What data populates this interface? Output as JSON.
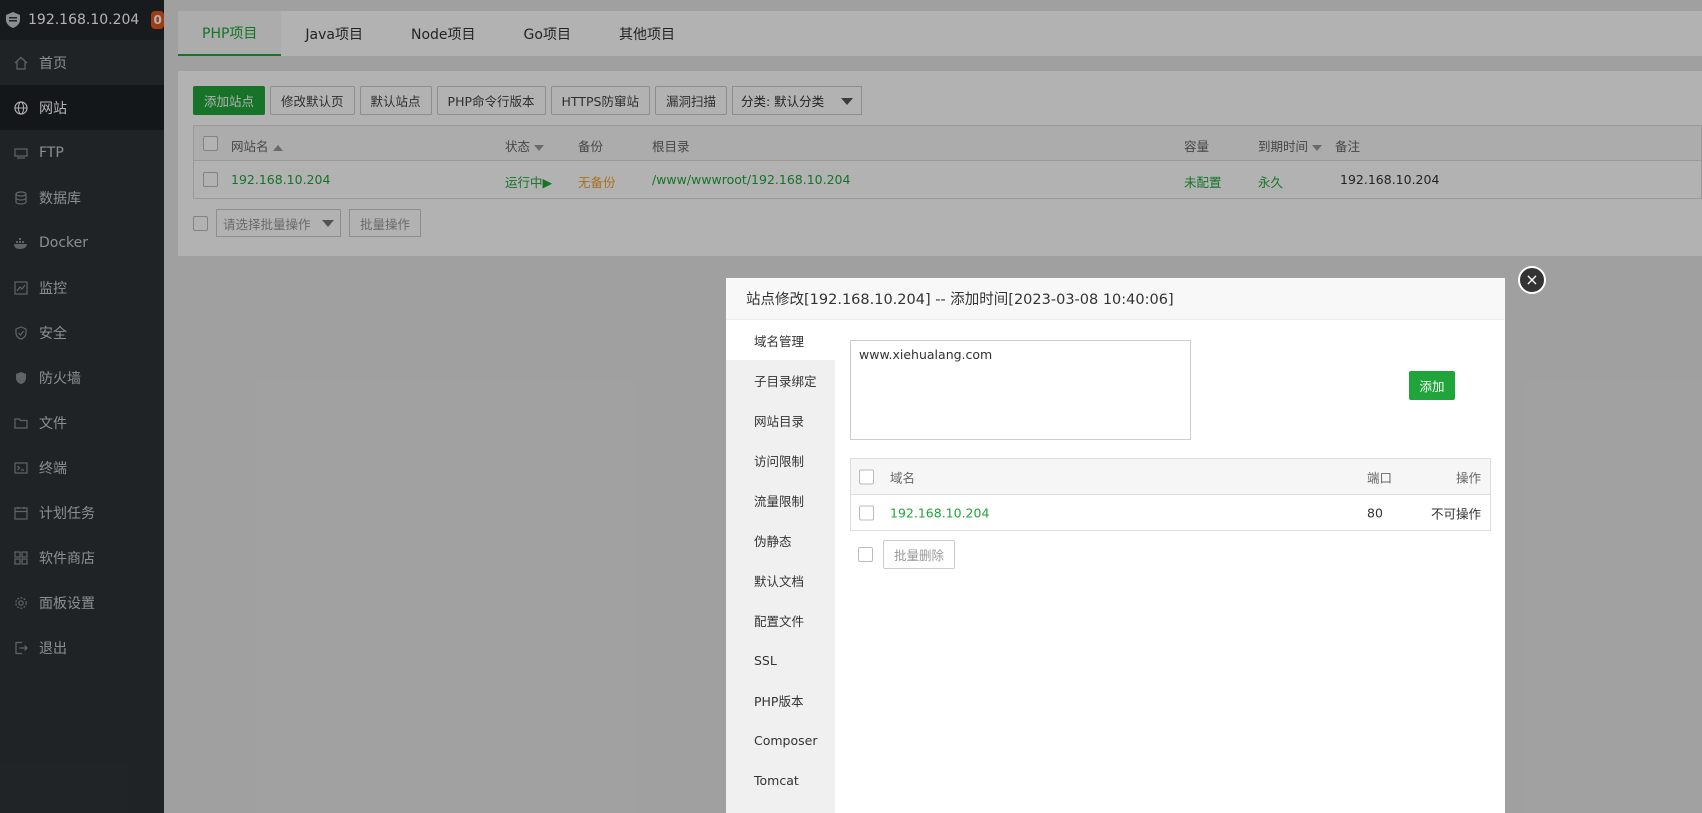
{
  "sidebar": {
    "server_ip": "192.168.10.204",
    "badge_count": "0",
    "items": [
      {
        "label": "首页",
        "icon": "home-icon"
      },
      {
        "label": "网站",
        "icon": "globe-icon"
      },
      {
        "label": "FTP",
        "icon": "ftp-icon"
      },
      {
        "label": "数据库",
        "icon": "database-icon"
      },
      {
        "label": "Docker",
        "icon": "docker-icon"
      },
      {
        "label": "监控",
        "icon": "monitor-icon"
      },
      {
        "label": "安全",
        "icon": "shield-icon"
      },
      {
        "label": "防火墙",
        "icon": "firewall-icon"
      },
      {
        "label": "文件",
        "icon": "folder-icon"
      },
      {
        "label": "终端",
        "icon": "terminal-icon"
      },
      {
        "label": "计划任务",
        "icon": "calendar-icon"
      },
      {
        "label": "软件商店",
        "icon": "apps-icon"
      },
      {
        "label": "面板设置",
        "icon": "gear-icon"
      },
      {
        "label": "退出",
        "icon": "logout-icon"
      }
    ],
    "active_index": 1
  },
  "tabs": [
    {
      "label": "PHP项目"
    },
    {
      "label": "Java项目"
    },
    {
      "label": "Node项目"
    },
    {
      "label": "Go项目"
    },
    {
      "label": "其他项目"
    }
  ],
  "toolbar": {
    "add_site": "添加站点",
    "modify_default_page": "修改默认页",
    "default_site": "默认站点",
    "php_cli_version": "PHP命令行版本",
    "https_anti_tamper": "HTTPS防窜站",
    "vuln_scan": "漏洞扫描",
    "category_select": "分类: 默认分类"
  },
  "site_table": {
    "headers": {
      "name": "网站名",
      "status": "状态",
      "backup": "备份",
      "root": "根目录",
      "capacity": "容量",
      "expire": "到期时间",
      "note": "备注"
    },
    "rows": [
      {
        "name": "192.168.10.204",
        "status": "运行中▶",
        "backup": "无备份",
        "root": "/www/wwwroot/192.168.10.204",
        "capacity": "未配置",
        "expire": "永久",
        "note": "192.168.10.204"
      }
    ]
  },
  "batch": {
    "select_placeholder": "请选择批量操作",
    "button": "批量操作"
  },
  "modal": {
    "title": "站点修改[192.168.10.204] -- 添加时间[2023-03-08 10:40:06]",
    "close": "×",
    "nav": [
      "域名管理",
      "子目录绑定",
      "网站目录",
      "访问限制",
      "流量限制",
      "伪静态",
      "默认文档",
      "配置文件",
      "SSL",
      "PHP版本",
      "Composer",
      "Tomcat"
    ],
    "nav_active_index": 0,
    "domain_input_value": "www.xiehualang.com",
    "add_button": "添加",
    "domain_table": {
      "headers": {
        "domain": "域名",
        "port": "端口",
        "action": "操作"
      },
      "rows": [
        {
          "domain": "192.168.10.204",
          "port": "80",
          "action": "不可操作"
        }
      ]
    },
    "batch_delete": "批量删除"
  },
  "colors": {
    "accent_green": "#20a53a",
    "sidebar_bg": "#2f3337",
    "badge_orange": "#e2561f",
    "warning_orange": "#f0a229"
  }
}
